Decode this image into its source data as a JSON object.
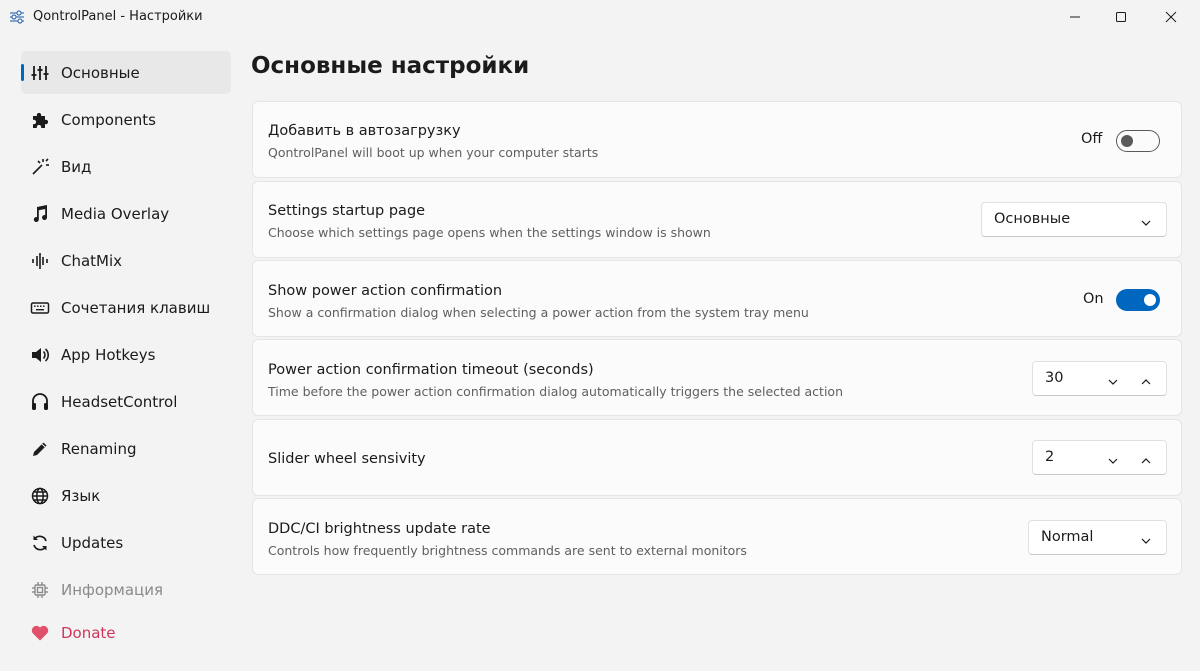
{
  "window": {
    "title": "QontrolPanel - Настройки",
    "app_icon": "sliders-icon"
  },
  "sidebar": {
    "items": [
      {
        "label": "Основные",
        "icon": "sliders-vertical-icon",
        "active": true
      },
      {
        "label": "Components",
        "icon": "puzzle-icon"
      },
      {
        "label": "Вид",
        "icon": "magic-wand-icon"
      },
      {
        "label": "Media Overlay",
        "icon": "music-note-icon"
      },
      {
        "label": "ChatMix",
        "icon": "waveform-icon"
      },
      {
        "label": "Сочетания клавиш",
        "icon": "keyboard-icon"
      },
      {
        "label": "App Hotkeys",
        "icon": "speaker-icon"
      },
      {
        "label": "HeadsetControl",
        "icon": "headset-icon"
      },
      {
        "label": "Renaming",
        "icon": "pencil-icon"
      },
      {
        "label": "Язык",
        "icon": "globe-icon"
      },
      {
        "label": "Updates",
        "icon": "refresh-icon"
      },
      {
        "label": "Информация",
        "icon": "chip-icon",
        "disabled": true
      },
      {
        "label": "Donate",
        "icon": "heart-icon",
        "accent": "#d1345b"
      }
    ]
  },
  "main": {
    "title": "Основные настройки",
    "settings": [
      {
        "title": "Добавить в автозагрузку",
        "description": "QontrolPanel will boot up when your computer starts",
        "control": "toggle",
        "state_label": "Off",
        "on": false
      },
      {
        "title": "Settings startup page",
        "description": "Choose which settings page opens when the settings window is shown",
        "control": "combo",
        "value": "Основные"
      },
      {
        "title": "Show power action confirmation",
        "description": "Show a confirmation dialog when selecting a power action from the system tray menu",
        "control": "toggle",
        "state_label": "On",
        "on": true
      },
      {
        "title": "Power action confirmation timeout (seconds)",
        "description": "Time before the power action confirmation dialog automatically triggers the selected action",
        "control": "spinbox",
        "value": "30"
      },
      {
        "title": "Slider wheel sensivity",
        "description": "",
        "control": "spinbox",
        "value": "2"
      },
      {
        "title": "DDC/CI brightness update rate",
        "description": "Controls how frequently brightness commands are sent to external monitors",
        "control": "combo",
        "value": "Normal"
      }
    ]
  },
  "colors": {
    "accent": "#0067c0",
    "donate": "#d1345b",
    "background": "#f3f3f3",
    "card": "#fbfbfb"
  }
}
